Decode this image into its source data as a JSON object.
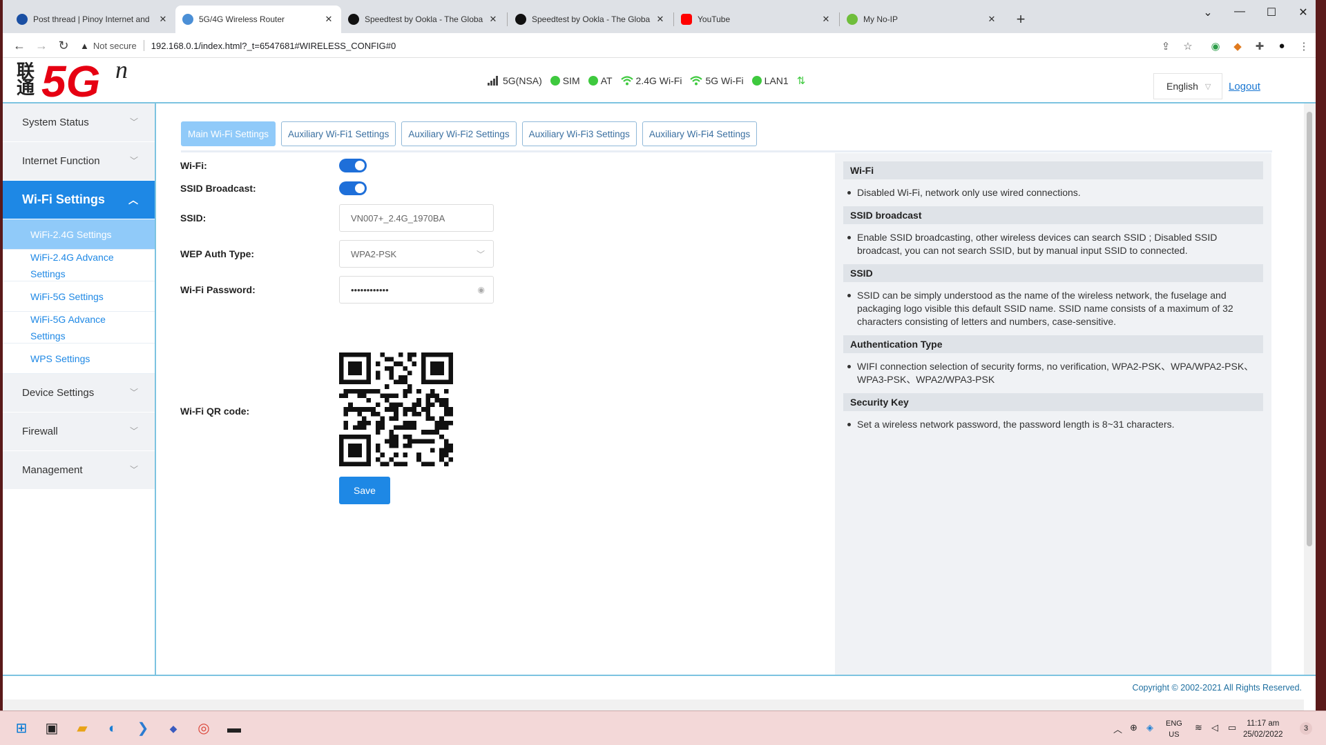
{
  "browser": {
    "tabs": [
      {
        "title": "Post thread | Pinoy Internet and",
        "fav": "#1a4fa3",
        "active": false
      },
      {
        "title": "5G/4G Wireless Router",
        "fav": "#4b8fd6",
        "active": true
      },
      {
        "title": "Speedtest by Ookla - The Globa",
        "fav": "#111111",
        "active": false
      },
      {
        "title": "Speedtest by Ookla - The Globa",
        "fav": "#111111",
        "active": false
      },
      {
        "title": "YouTube",
        "fav": "#ff0000",
        "active": false
      },
      {
        "title": "My No-IP",
        "fav": "#6fbe3b",
        "active": false
      }
    ],
    "not_secure": "Not secure",
    "url": "192.168.0.1/index.html?_t=6547681#WIRELESS_CONFIG#0"
  },
  "header": {
    "logo_cn": "联通",
    "logo_5g": "5G",
    "logo_n": "n",
    "status": {
      "network": "5G(NSA)",
      "sim": "SIM",
      "at": "AT",
      "wifi24": "2.4G Wi-Fi",
      "wifi5": "5G Wi-Fi",
      "lan": "LAN1"
    },
    "language": "English",
    "logout": "Logout"
  },
  "sidebar": {
    "groups": [
      {
        "label": "System Status"
      },
      {
        "label": "Internet Function"
      },
      {
        "label": "Wi-Fi Settings",
        "active": true
      },
      {
        "label": "Device Settings"
      },
      {
        "label": "Firewall"
      },
      {
        "label": "Management"
      }
    ],
    "wifi_items": [
      {
        "label": "WiFi-2.4G Settings",
        "selected": true
      },
      {
        "label": "WiFi-2.4G Advance Settings"
      },
      {
        "label": "WiFi-5G Settings"
      },
      {
        "label": "WiFi-5G Advance Settings"
      },
      {
        "label": "WPS Settings"
      }
    ]
  },
  "tabs": [
    {
      "label": "Main Wi-Fi Settings",
      "active": true
    },
    {
      "label": "Auxiliary Wi-Fi1 Settings"
    },
    {
      "label": "Auxiliary Wi-Fi2 Settings"
    },
    {
      "label": "Auxiliary Wi-Fi3 Settings"
    },
    {
      "label": "Auxiliary Wi-Fi4 Settings"
    }
  ],
  "form": {
    "wifi_label": "Wi-Fi:",
    "wifi_on": true,
    "ssid_broadcast_label": "SSID Broadcast:",
    "ssid_broadcast_on": true,
    "ssid_label": "SSID:",
    "ssid_value": "VN007+_2.4G_1970BA",
    "auth_label": "WEP Auth Type:",
    "auth_value": "WPA2-PSK",
    "password_label": "Wi-Fi Password:",
    "password_value": "••••••••••••",
    "qr_label": "Wi-Fi QR code:",
    "save_label": "Save"
  },
  "help": [
    {
      "title": "Wi-Fi",
      "body": "Disabled Wi-Fi, network only use wired connections."
    },
    {
      "title": "SSID broadcast",
      "body": "Enable SSID broadcasting, other wireless devices can search SSID ; Disabled SSID broadcast, you can not search SSID, but by manual input SSID to connected."
    },
    {
      "title": "SSID",
      "body": "SSID can be simply understood as the name of the wireless network, the fuselage and packaging logo visible this default SSID name. SSID name consists of a maximum of 32 characters consisting of letters and numbers, case-sensitive."
    },
    {
      "title": "Authentication Type",
      "body": "WIFI connection selection of security forms, no verification, WPA2-PSK、WPA/WPA2-PSK、WPA3-PSK、WPA2/WPA3-PSK"
    },
    {
      "title": "Security Key",
      "body": "Set a wireless network password, the password length is 8~31 characters."
    }
  ],
  "footer": {
    "copyright": "Copyright © 2002-2021 All Rights Reserved."
  },
  "taskbar": {
    "lang_top": "ENG",
    "lang_bottom": "US",
    "time": "11:17 am",
    "date": "25/02/2022",
    "notifications": "3"
  },
  "colors": {
    "accent": "#1e88e5",
    "brand": "#e60012",
    "status_green": "#3ec93e"
  }
}
